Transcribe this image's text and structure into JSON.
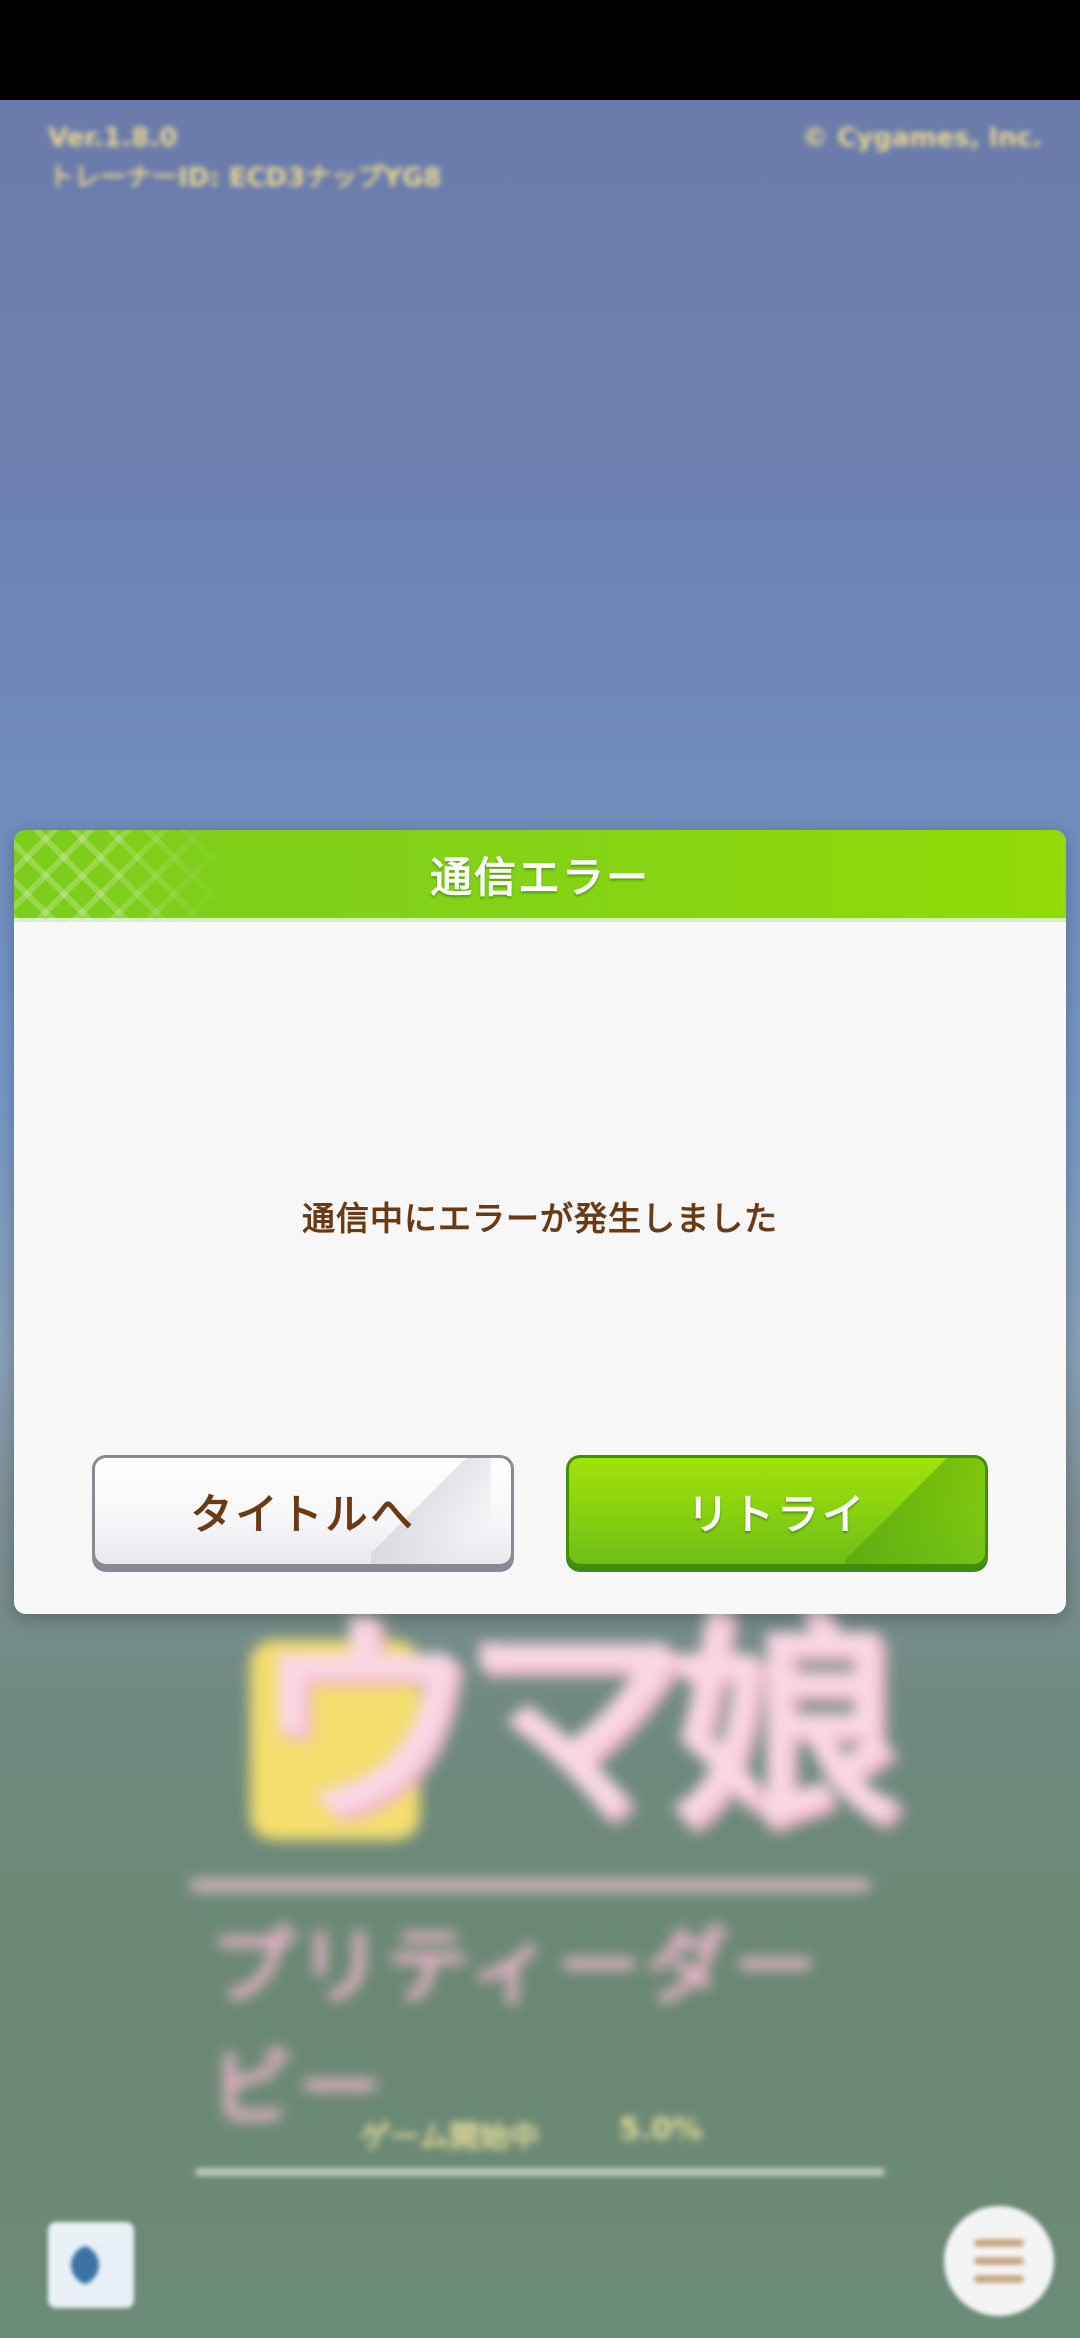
{
  "background": {
    "version_text": "Ver.1.8.0",
    "trainer_id_text": "トレーナーID: ECD3ナップYG8",
    "copyright_text": "© Cygames, Inc.",
    "logo_main_text": "ウマ娘",
    "logo_sub_text": "プリティーダービー",
    "bottom_left_text": "ゲーム開始中",
    "bottom_right_text": "5.0%"
  },
  "dialog": {
    "title": "通信エラー",
    "message": "通信中にエラーが発生しました",
    "title_button_label": "タイトルへ",
    "retry_button_label": "リトライ"
  },
  "colors": {
    "header_green": "#86d414",
    "message_brown": "#6a3a14",
    "retry_green": "#86d011"
  },
  "icons": {
    "menu": "hamburger-icon",
    "corner_badge": "moon-icon"
  }
}
